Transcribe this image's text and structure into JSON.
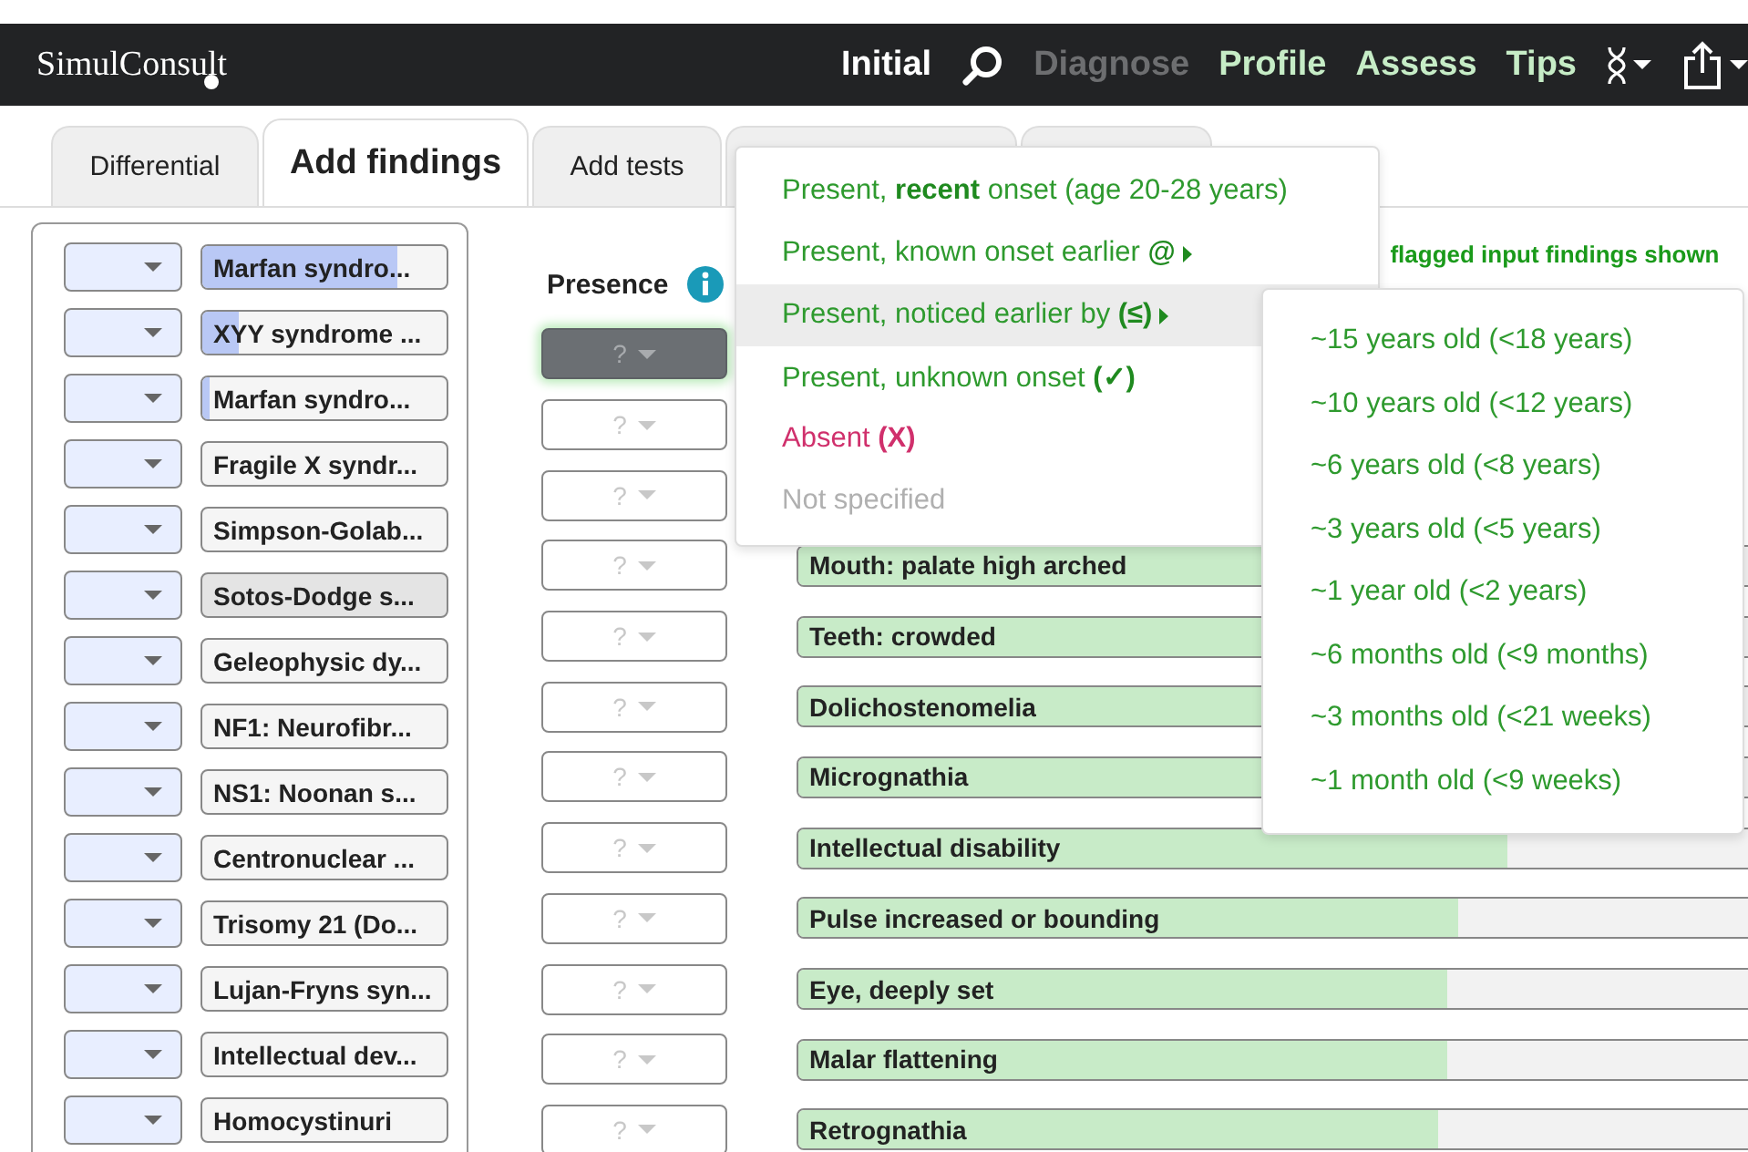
{
  "navbar": {
    "logo": "SimulConsult",
    "links": [
      {
        "label": "Initial",
        "kind": "current"
      },
      {
        "kind": "search"
      },
      {
        "label": "Diagnose",
        "kind": "disabled"
      },
      {
        "label": "Profile",
        "kind": "link"
      },
      {
        "label": "Assess",
        "kind": "link"
      },
      {
        "label": "Tips",
        "kind": "link"
      },
      {
        "kind": "dna"
      },
      {
        "kind": "share"
      }
    ]
  },
  "tabs": [
    {
      "label": "Differential",
      "selected": false
    },
    {
      "label": "Add findings",
      "selected": true
    },
    {
      "label": "Add tests",
      "selected": false
    },
    {
      "selected": false
    },
    {
      "selected": false
    }
  ],
  "diagnoses": [
    {
      "name": "Marfan syndro...",
      "level": 0.8,
      "selected": false
    },
    {
      "name": "XYY syndrome ...",
      "level": 0.15,
      "selected": false
    },
    {
      "name": "Marfan syndro...",
      "level": 0.03,
      "selected": false
    },
    {
      "name": "Fragile X syndr...",
      "selected": false
    },
    {
      "name": "Simpson-Golab...",
      "selected": false
    },
    {
      "name": "Sotos-Dodge s...",
      "selected": true
    },
    {
      "name": "Geleophysic dy...",
      "selected": false
    },
    {
      "name": "NF1: Neurofibr...",
      "selected": false
    },
    {
      "name": "NS1: Noonan s...",
      "selected": false
    },
    {
      "name": "Centronuclear ...",
      "selected": false
    },
    {
      "name": "Trisomy 21 (Do...",
      "selected": false
    },
    {
      "name": "Lujan-Fryns syn...",
      "selected": false
    },
    {
      "name": "Intellectual dev...",
      "selected": false
    },
    {
      "name": "Homocystinuri",
      "selected": false
    }
  ],
  "presence_header": "Presence",
  "flagged_note": "flagged input findings shown",
  "findings": [
    {
      "presence": "?",
      "open": true
    },
    {
      "presence": "?",
      "open": false
    },
    {
      "presence": "?",
      "open": false
    },
    {
      "presence": "?",
      "open": false,
      "name": "Mouth: palate high arched",
      "level": 0.8
    },
    {
      "presence": "?",
      "open": false,
      "name": "Teeth: crowded",
      "level": 0.8
    },
    {
      "presence": "?",
      "open": false,
      "name": "Dolichostenomelia",
      "level": 0.78
    },
    {
      "presence": "?",
      "open": false,
      "name": "Micrognathia",
      "level": 0.76
    },
    {
      "presence": "?",
      "open": false,
      "name": "Intellectual disability",
      "level": 0.72
    },
    {
      "presence": "?",
      "open": false,
      "name": "Pulse increased or bounding",
      "level": 0.67
    },
    {
      "presence": "?",
      "open": false,
      "name": "Eye, deeply set",
      "level": 0.66
    },
    {
      "presence": "?",
      "open": false,
      "name": "Malar flattening",
      "level": 0.66
    },
    {
      "presence": "?",
      "open": false,
      "name": "Retrognathia",
      "level": 0.65
    }
  ],
  "menu": [
    {
      "label": "Present, **recent** onset (age 20-28 years)",
      "kind": "present",
      "submenu": false,
      "selected": false
    },
    {
      "label": "Present, known onset earlier **@**",
      "kind": "present",
      "submenu": true,
      "selected": false
    },
    {
      "label": "Present, noticed earlier by **(≤)**",
      "kind": "present",
      "submenu": true,
      "selected": true
    },
    {
      "label": "Present, unknown onset **(✓)**",
      "kind": "present",
      "submenu": false,
      "selected": false
    },
    {
      "label": "Absent **(X)**",
      "kind": "absent",
      "submenu": false,
      "selected": false
    },
    {
      "label": "Not specified",
      "kind": "unspecified",
      "submenu": false,
      "selected": false
    }
  ],
  "submenu": [
    "~15 years old (<18 years)",
    "~10 years old (<12 years)",
    "~6 years old (<8 years)",
    "~3 years old (<5 years)",
    "~1 year old (<2 years)",
    "~6 months old (<9 months)",
    "~3 months old (<21 weeks)",
    "~1 month old (<9 weeks)"
  ]
}
